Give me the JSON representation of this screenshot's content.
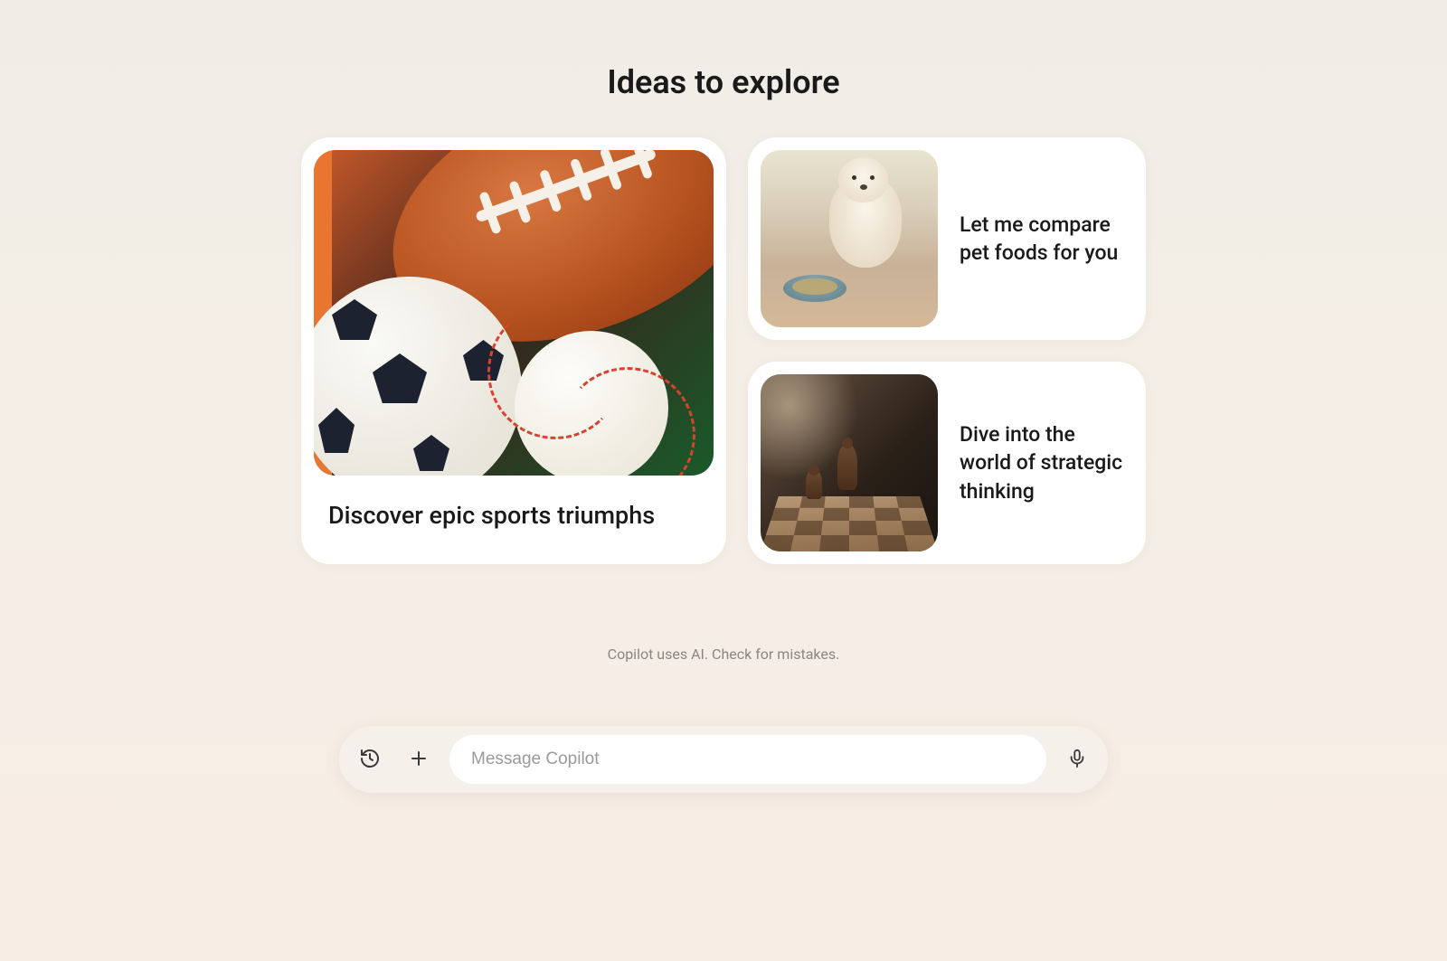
{
  "page": {
    "title": "Ideas to explore"
  },
  "cards": {
    "large": {
      "title": "Discover epic sports triumphs",
      "image_name": "sports-balls-illustration"
    },
    "small": [
      {
        "title": "Let me compare pet foods for you",
        "image_name": "dog-food-bowl-painting"
      },
      {
        "title": "Dive into the world of strategic thinking",
        "image_name": "chess-board-painting"
      }
    ]
  },
  "disclaimer": "Copilot uses AI. Check for mistakes.",
  "input": {
    "placeholder": "Message Copilot",
    "value": ""
  },
  "icons": {
    "history": "history-icon",
    "add": "plus-icon",
    "microphone": "microphone-icon"
  }
}
